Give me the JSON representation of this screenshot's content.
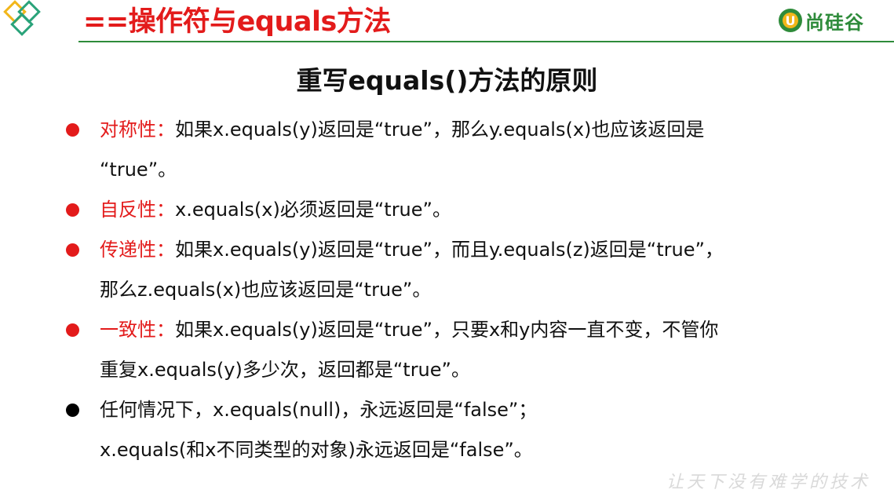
{
  "header": {
    "title": "==操作符与equals方法",
    "logo_text": "尚硅谷",
    "logo_mark_letter": "U"
  },
  "content": {
    "subtitle": "重写equals()方法的原则",
    "bullets": [
      {
        "term": "对称性：",
        "line1": "如果x.equals(y)返回是“true”，那么y.equals(x)也应该返回是",
        "line2": "“true”。",
        "color": "red"
      },
      {
        "term": "自反性：",
        "line1": "x.equals(x)必须返回是“true”。",
        "line2": "",
        "color": "red"
      },
      {
        "term": "传递性：",
        "line1": "如果x.equals(y)返回是“true”，而且y.equals(z)返回是“true”，",
        "line2": "那么z.equals(x)也应该返回是“true”。",
        "color": "red"
      },
      {
        "term": "一致性：",
        "line1": "如果x.equals(y)返回是“true”，只要x和y内容一直不变，不管你",
        "line2": "重复x.equals(y)多少次，返回都是“true”。",
        "color": "red"
      },
      {
        "term": "",
        "line1": "任何情况下，x.equals(null)，永远返回是“false”；",
        "line2": "x.equals(和x不同类型的对象)永远返回是“false”。",
        "color": "black"
      }
    ]
  },
  "footer": {
    "watermark": "让天下没有难学的技术"
  },
  "colors": {
    "accent_red": "#e31b1b",
    "brand_green": "#2e8b3a",
    "diamond_yellow": "#f2b61a",
    "diamond_teal": "#2aa37a"
  }
}
